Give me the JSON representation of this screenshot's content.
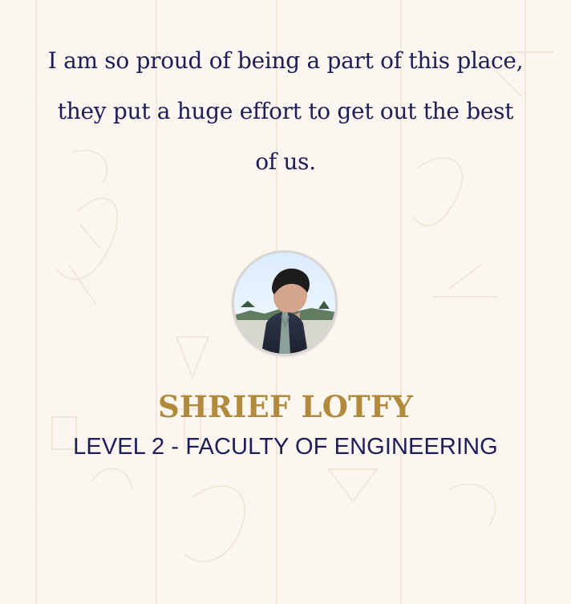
{
  "testimonial": {
    "quote": "I am so proud of being a part of this place, they put a huge effort to get out the best of us.",
    "name": "SHRIEF LOTFY",
    "subtitle": "LEVEL 2 - FACULTY OF ENGINEERING"
  },
  "colors": {
    "background": "#fbf7f0",
    "quote_text": "#1f1c5a",
    "name_text": "#b18a3d",
    "subtitle_text": "#1f1c5a"
  }
}
